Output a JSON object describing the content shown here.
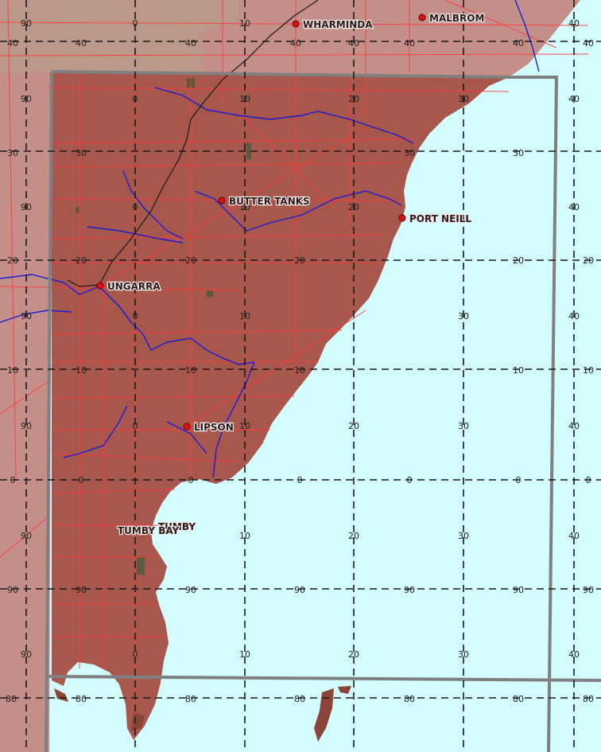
{
  "colors": {
    "sea": "#d2fcfd",
    "land_outside": "#c48e89",
    "land_inside": "#a8574d",
    "roads": "#ff3b3b",
    "rivers": "#1c1cd4",
    "railway": "#1a1a1a",
    "frame": "#808080",
    "grid": "#1a1a1a",
    "town_marker": "#e01010"
  },
  "towns": [
    {
      "id": "wharminda",
      "name": "WHARMINDA"
    },
    {
      "id": "malbrom",
      "name": "MALBROM"
    },
    {
      "id": "butter-tanks",
      "name": "BUTTER TANKS"
    },
    {
      "id": "port-neill",
      "name": "PORT NEILL"
    },
    {
      "id": "ungarra",
      "name": "UNGARRA"
    },
    {
      "id": "lipson",
      "name": "LIPSON"
    },
    {
      "id": "tumby",
      "name": "TUMBY"
    },
    {
      "id": "tumby-bay",
      "name": "TUMBY BAY"
    }
  ],
  "grid_labels": {
    "r1": [
      "90",
      "0",
      "10",
      "40",
      "40",
      "40"
    ],
    "r2": [
      "40",
      "40",
      "40",
      "40",
      "40",
      "40"
    ],
    "r3": [
      "90",
      "0",
      "10",
      "20",
      "30",
      "40"
    ],
    "r4": [
      "30",
      "30",
      "30",
      "30"
    ],
    "r5": [
      "90",
      "0",
      "10",
      "20",
      "40"
    ],
    "r6": [
      "20",
      "20",
      "20",
      "20",
      "20",
      "20"
    ],
    "r7": [
      "90",
      "0",
      "10",
      "30",
      "40"
    ],
    "r8": [
      "10",
      "10",
      "10",
      "10",
      "10",
      "10"
    ],
    "r9": [
      "90",
      "0",
      "10",
      "20",
      "30",
      "40"
    ],
    "r10": [
      "0",
      "0",
      "0",
      "0",
      "0",
      "0",
      "0"
    ],
    "r11": [
      "90",
      "10",
      "20",
      "30",
      "40"
    ],
    "r12": [
      "90",
      "90",
      "90",
      "90",
      "90",
      "90",
      "90"
    ],
    "r13": [
      "90",
      "0",
      "10",
      "20",
      "30",
      "40"
    ],
    "r14": [
      "80",
      "80",
      "80",
      "80",
      "80",
      "80",
      "80"
    ]
  }
}
